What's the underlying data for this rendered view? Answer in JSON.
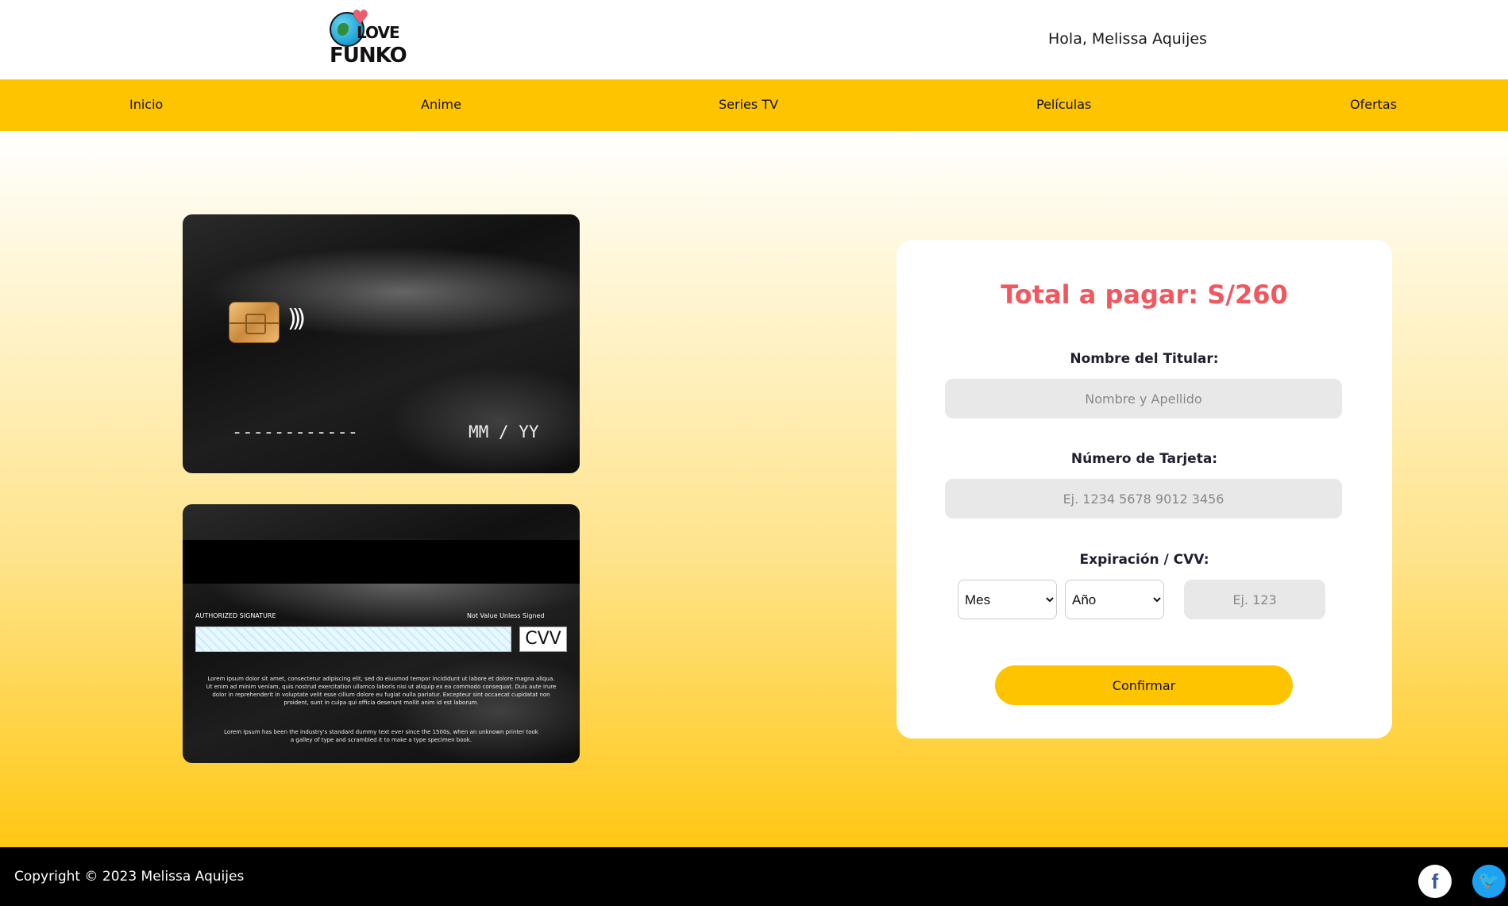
{
  "header": {
    "logo_top": "LOVE",
    "logo_bottom": "FUNKO",
    "greeting": "Hola, Melissa Aquijes"
  },
  "nav": {
    "items": [
      {
        "label": "Inicio"
      },
      {
        "label": "Anime"
      },
      {
        "label": "Series TV"
      },
      {
        "label": "Películas"
      },
      {
        "label": "Ofertas"
      }
    ]
  },
  "card_front": {
    "number": "------------",
    "expiry": "MM / YY"
  },
  "card_back": {
    "authorized_signature": "AUTHORIZED SIGNATURE",
    "not_valid": "Not Value Unless Signed",
    "cvv": "CVV",
    "text1": "Lorem ipsum dolor sit amet, consectetur adipiscing elit, sed do eiusmod tempor incididunt ut labore et dolore magna aliqua. Ut enim ad minim veniam, quis nostrud exercitation ullamco laboris nisi ut aliquip ex ea commodo consequat. Duis aute irure dolor in reprehenderit in voluptate velit esse cillum dolore eu fugiat nulla pariatur. Excepteur sint occaecat cupidatat non proident, sunt in culpa qui officia deserunt mollit anim id est laborum.",
    "text2": "Lorem Ipsum has been the industry's standard dummy text ever since the 1500s, when an unknown printer took a galley of type and scrambled it to make a type specimen book."
  },
  "form": {
    "total": "Total a pagar: S/260",
    "name_label": "Nombre del Titular:",
    "name_placeholder": "Nombre y Apellido",
    "card_label": "Número de Tarjeta:",
    "card_placeholder": "Ej. 1234 5678 9012 3456",
    "exp_label": "Expiración / CVV:",
    "month_selected": "Mes",
    "year_selected": "Año",
    "cvv_placeholder": "Ej. 123",
    "confirm_label": "Confirmar"
  },
  "footer": {
    "copyright": "Copyright © 2023 Melissa Aquijes",
    "facebook_glyph": "f",
    "twitter_glyph": "🐦"
  },
  "colors": {
    "accent": "#ffc400",
    "total": "#f0575e"
  }
}
